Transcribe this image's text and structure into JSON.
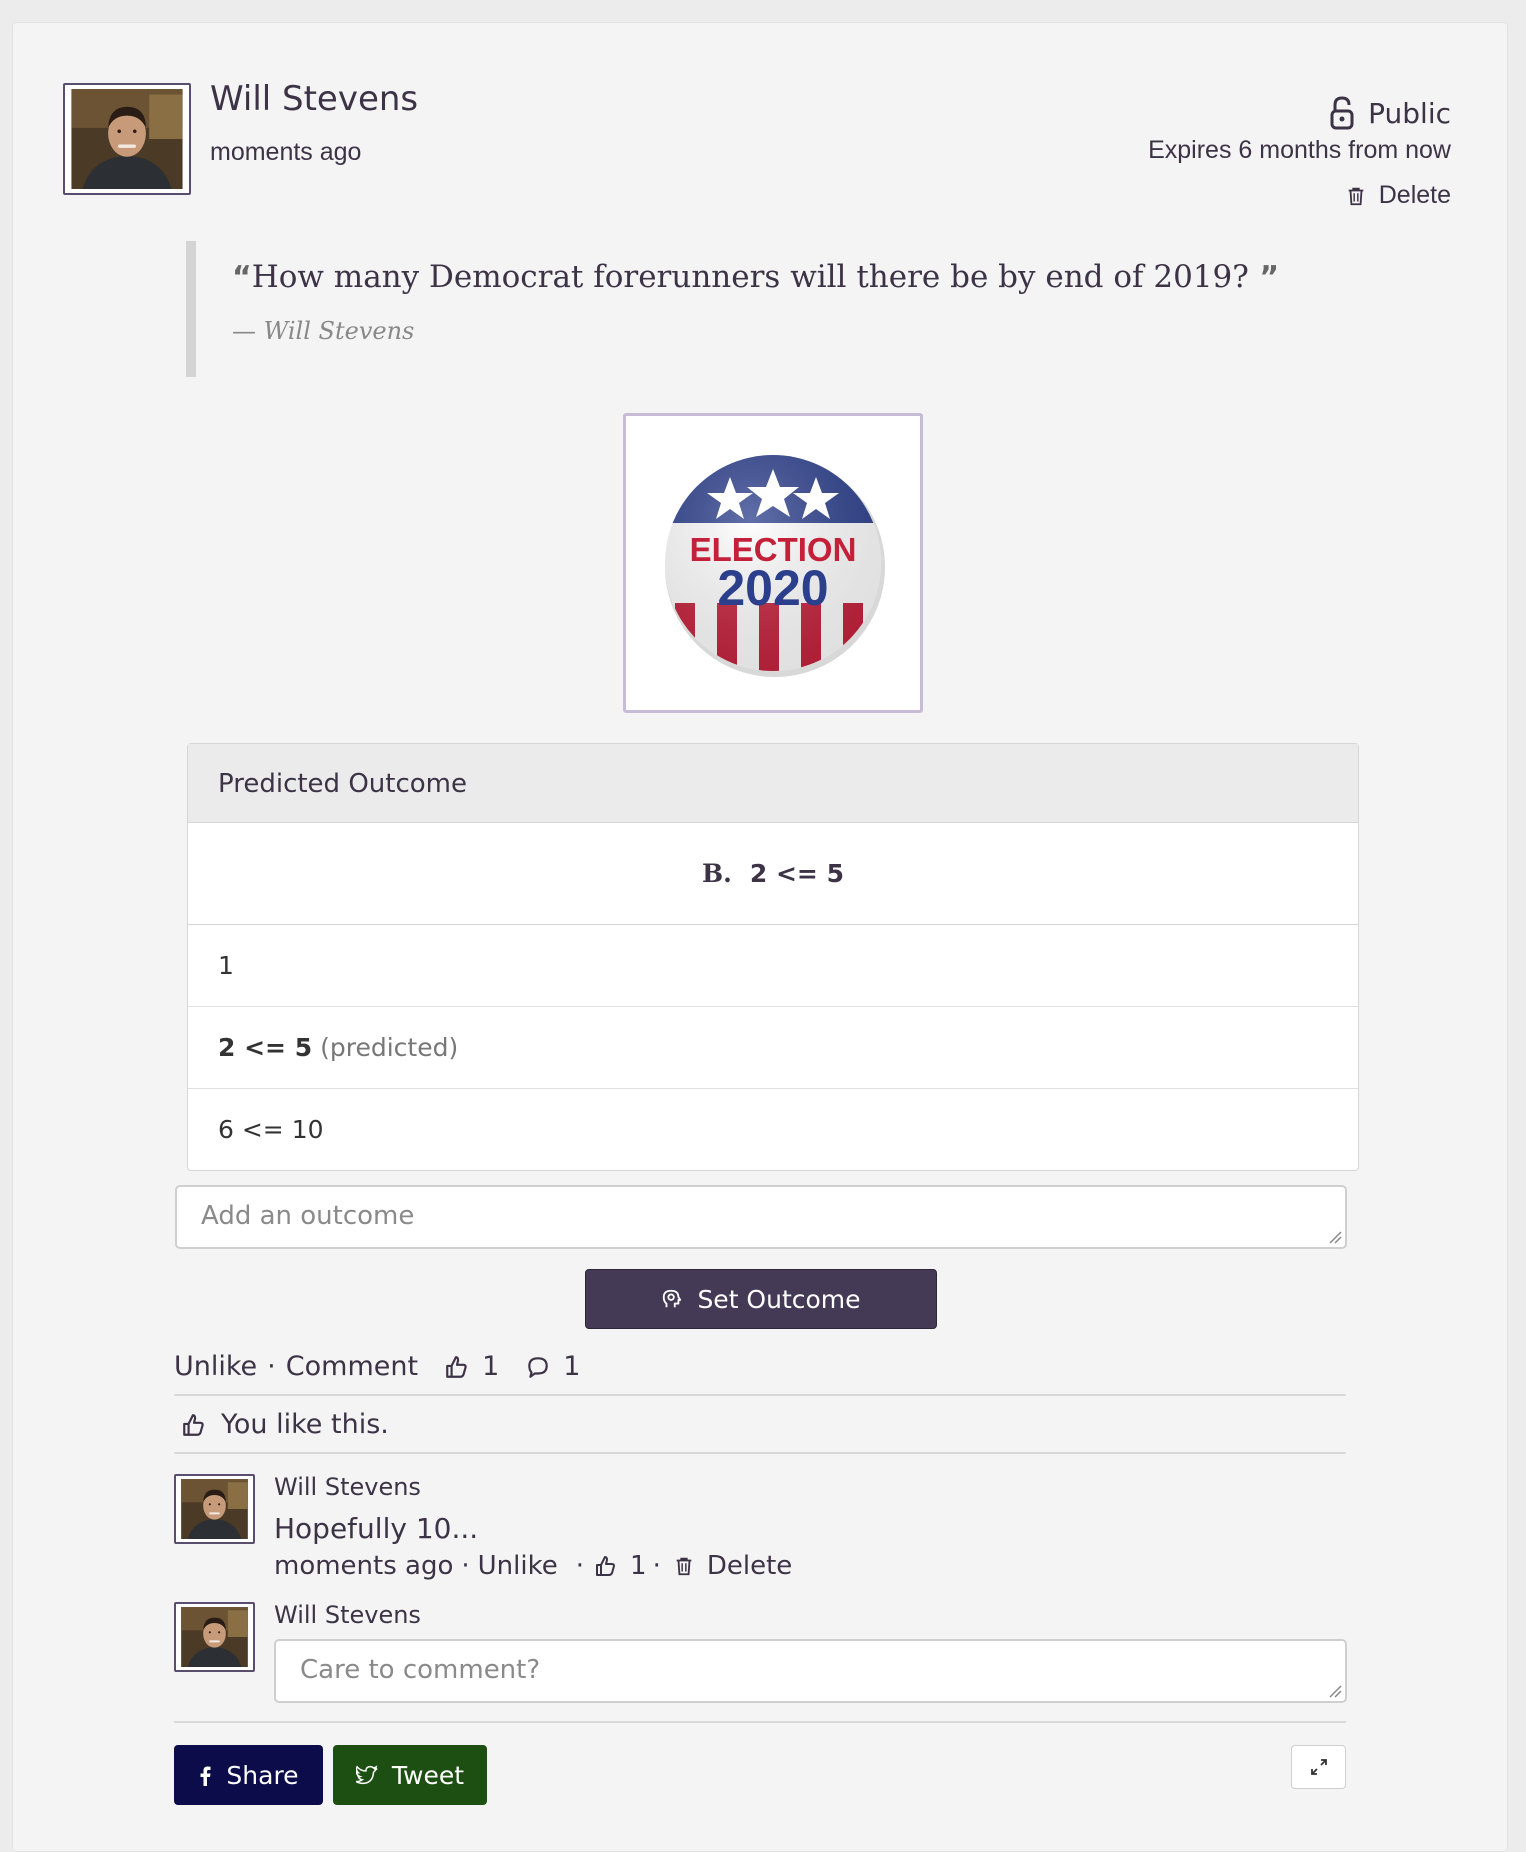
{
  "post": {
    "author": "Will Stevens",
    "time": "moments ago",
    "visibility": "Public",
    "expires": "Expires 6 months from now",
    "delete_label": "Delete",
    "quote_text": "How many Democrat forerunners will there be by end of 2019?",
    "quote_cite": "— Will Stevens",
    "image_badge": {
      "line1": "ELECTION",
      "line2": "2020"
    }
  },
  "outcome": {
    "header": "Predicted Outcome",
    "predicted_letter": "B.",
    "predicted_value": "2 <= 5",
    "rows": [
      {
        "value": "1",
        "note": ""
      },
      {
        "value": "2 <= 5",
        "note": "(predicted)"
      },
      {
        "value": "6 <= 10",
        "note": ""
      }
    ],
    "add_placeholder": "Add an outcome",
    "set_button": "Set Outcome"
  },
  "actions": {
    "unlike": "Unlike",
    "dot": "·",
    "comment": "Comment",
    "like_count": "1",
    "comment_count": "1",
    "you_like": "You like this."
  },
  "comments": [
    {
      "author": "Will Stevens",
      "text": "Hopefully 10...",
      "time": "moments ago",
      "unlike": "Unlike",
      "likes": "1",
      "delete": "Delete"
    }
  ],
  "new_comment": {
    "author": "Will Stevens",
    "placeholder": "Care to comment?"
  },
  "share": {
    "share_label": "Share",
    "tweet_label": "Tweet"
  },
  "colors": {
    "text": "#3d3346",
    "button_primary": "#453a55",
    "share_bg": "#0c0c4a",
    "tweet_bg": "#1d4f12"
  }
}
